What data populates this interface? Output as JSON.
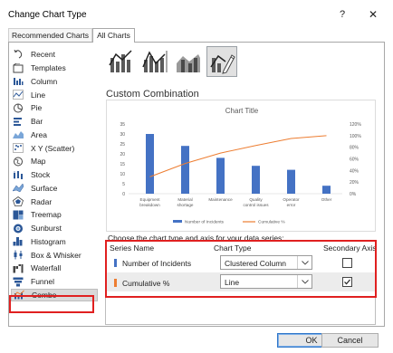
{
  "window": {
    "title": "Change Chart Type",
    "help_glyph": "?",
    "close_glyph": "✕"
  },
  "tabs": [
    {
      "label": "Recommended Charts",
      "selected": false
    },
    {
      "label": "All Charts",
      "selected": true
    }
  ],
  "sidebar": {
    "items": [
      {
        "label": "Recent",
        "icon": "recent-icon"
      },
      {
        "label": "Templates",
        "icon": "templates-icon"
      },
      {
        "label": "Column",
        "icon": "column-icon"
      },
      {
        "label": "Line",
        "icon": "line-icon"
      },
      {
        "label": "Pie",
        "icon": "pie-icon"
      },
      {
        "label": "Bar",
        "icon": "bar-icon"
      },
      {
        "label": "Area",
        "icon": "area-icon"
      },
      {
        "label": "X Y (Scatter)",
        "icon": "scatter-icon"
      },
      {
        "label": "Map",
        "icon": "map-icon"
      },
      {
        "label": "Stock",
        "icon": "stock-icon"
      },
      {
        "label": "Surface",
        "icon": "surface-icon"
      },
      {
        "label": "Radar",
        "icon": "radar-icon"
      },
      {
        "label": "Treemap",
        "icon": "treemap-icon"
      },
      {
        "label": "Sunburst",
        "icon": "sunburst-icon"
      },
      {
        "label": "Histogram",
        "icon": "histogram-icon"
      },
      {
        "label": "Box & Whisker",
        "icon": "box-whisker-icon"
      },
      {
        "label": "Waterfall",
        "icon": "waterfall-icon"
      },
      {
        "label": "Funnel",
        "icon": "funnel-icon"
      },
      {
        "label": "Combo",
        "icon": "combo-icon",
        "selected": true
      }
    ]
  },
  "combo_types": [
    {
      "name": "clustered-column-line-icon"
    },
    {
      "name": "clustered-column-line-secondary-icon"
    },
    {
      "name": "stacked-area-column-icon"
    },
    {
      "name": "custom-combination-icon",
      "selected": true
    }
  ],
  "section_title": "Custom Combination",
  "chart_data": {
    "type": "bar",
    "title": "Chart Title",
    "categories": [
      "Equipment breakdown",
      "Material shortage",
      "Maintenance",
      "Quality control issues",
      "Operator error",
      "Other"
    ],
    "category_lines": [
      [
        "Equipment",
        "breakdown"
      ],
      [
        "Material",
        "shortage"
      ],
      [
        "Maintenance"
      ],
      [
        "Quality",
        "control issues"
      ],
      [
        "Operator",
        "error"
      ],
      [
        "Other"
      ]
    ],
    "series": [
      {
        "name": "Number of Incidents",
        "type": "column",
        "axis": "primary",
        "color": "#4472c4",
        "values": [
          30,
          24,
          18,
          14,
          12,
          4
        ]
      },
      {
        "name": "Cumulative %",
        "type": "line",
        "axis": "secondary",
        "color": "#ed7d31",
        "values": [
          29,
          52,
          70,
          83,
          95,
          100
        ]
      }
    ],
    "y_primary": {
      "min": 0,
      "max": 35,
      "ticks": [
        "0",
        "5",
        "10",
        "15",
        "20",
        "25",
        "30",
        "35"
      ]
    },
    "y_secondary": {
      "min": 0,
      "max": 120,
      "ticks": [
        "0%",
        "20%",
        "40%",
        "60%",
        "80%",
        "100%",
        "120%"
      ]
    },
    "legend": [
      "Number of Incidents",
      "Cumulative %"
    ],
    "legend_position": "bottom",
    "grid": false
  },
  "series_table": {
    "prompt": "Choose the chart type and axis for your data series:",
    "headers": {
      "name": "Series Name",
      "type": "Chart Type",
      "secondary": "Secondary Axis"
    },
    "rows": [
      {
        "name": "Number of Incidents",
        "color": "#4472c4",
        "chart_type": "Clustered Column",
        "secondary": false
      },
      {
        "name": "Cumulative %",
        "color": "#ed7d31",
        "chart_type": "Line",
        "secondary": true
      }
    ]
  },
  "buttons": {
    "ok": "OK",
    "cancel": "Cancel"
  },
  "colors": {
    "accent": "#2e75c8",
    "highlight": "#e02020",
    "column": "#4472c4",
    "line": "#ed7d31"
  }
}
